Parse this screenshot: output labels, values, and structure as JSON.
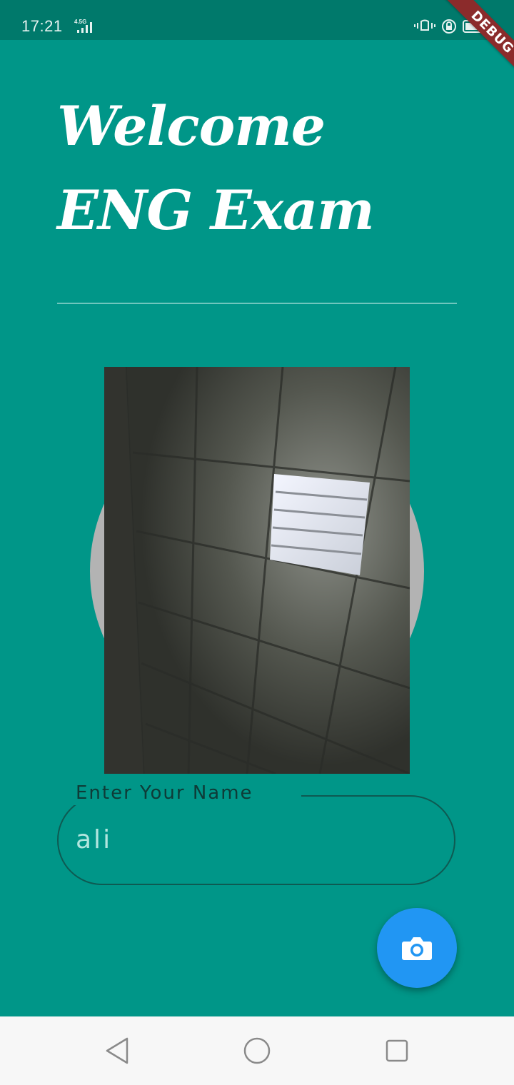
{
  "status_bar": {
    "time": "17:21",
    "network": "4.5G",
    "debug_banner": "DEBUG"
  },
  "header": {
    "title": "Welcome ENG Exam"
  },
  "form": {
    "name_label": "Enter Your Name",
    "name_value": "ali"
  },
  "fab": {
    "icon": "camera-icon",
    "color": "#2196f3"
  },
  "colors": {
    "background": "#009688",
    "status_bar": "#00796b"
  },
  "nav": {
    "back_icon": "back-triangle-icon",
    "home_icon": "home-circle-icon",
    "recents_icon": "recents-square-icon"
  }
}
